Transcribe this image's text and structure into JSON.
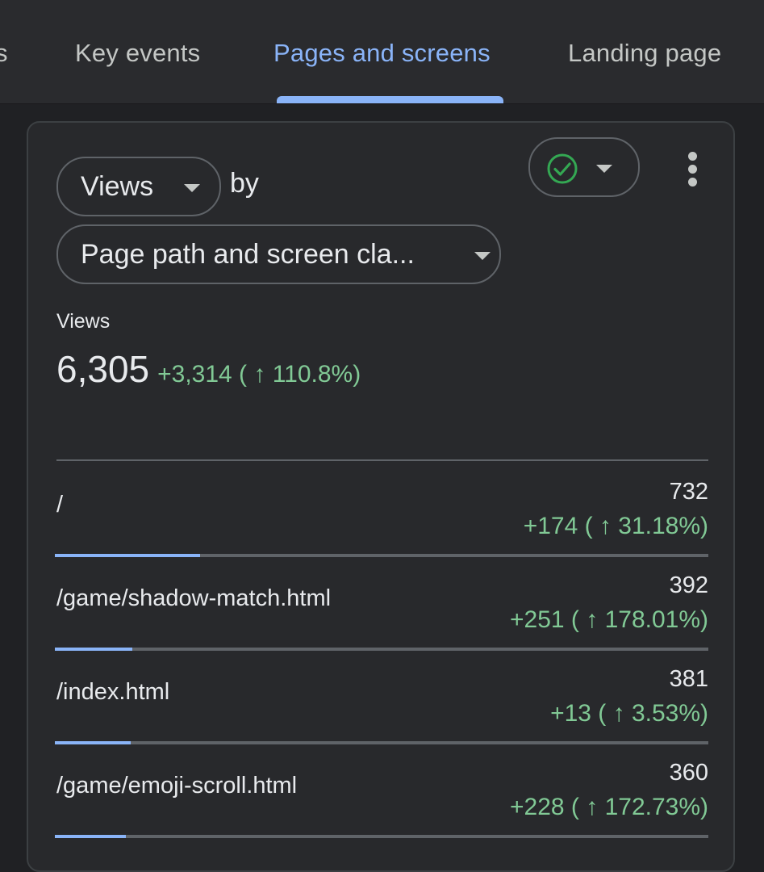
{
  "tabs": [
    {
      "label": "s",
      "active": false
    },
    {
      "label": "Key events",
      "active": false
    },
    {
      "label": "Pages and screens",
      "active": true
    },
    {
      "label": "Landing page",
      "active": false
    }
  ],
  "card": {
    "metric_chip": "Views",
    "by_label": "by",
    "dimension_chip": "Page path and screen cla...",
    "status_icon": "check-circle-icon",
    "metric": {
      "label": "Views",
      "value": "6,305",
      "delta": "+3,314 ( ↑ 110.8%)"
    },
    "rows": [
      {
        "path": "/",
        "count": "732",
        "change": "+174 ( ↑ 31.18%)",
        "share": 0.222
      },
      {
        "path": "/game/shadow-match.html",
        "count": "392",
        "change": "+251 ( ↑ 178.01%)",
        "share": 0.119
      },
      {
        "path": "/index.html",
        "count": "381",
        "change": "+13 ( ↑ 3.53%)",
        "share": 0.116
      },
      {
        "path": "/game/emoji-scroll.html",
        "count": "360",
        "change": "+228 ( ↑ 172.73%)",
        "share": 0.109
      }
    ]
  },
  "colors": {
    "accent": "#8ab4f8",
    "positive": "#81c995",
    "status_ok": "#34a853"
  }
}
